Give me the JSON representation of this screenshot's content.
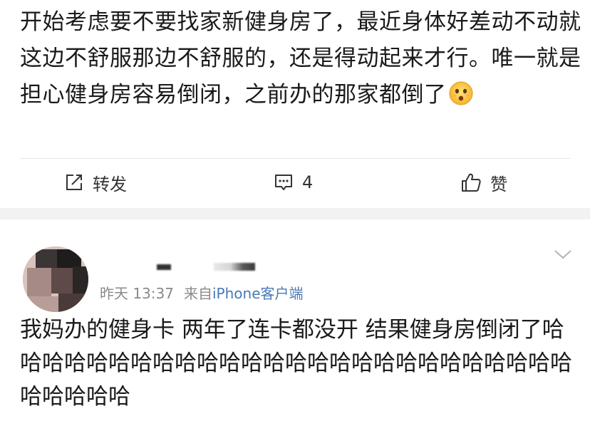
{
  "post": {
    "text": "开始考虑要不要找家新健身房了，最近身体好差动不动就这边不舒服那边不舒服的，还是得动起来才行。唯一就是担心健身房容易倒闭，之前办的那家都倒了",
    "emoji": "hushed-face-emoji",
    "actions": {
      "repost_label": "转发",
      "comment_count": "4",
      "like_label": "赞"
    }
  },
  "comment": {
    "time": "昨天 13:37",
    "source_prefix": "来自",
    "source_client": "iPhone客户端",
    "text": "我妈办的健身卡 两年了连卡都没开 结果健身房倒闭了哈哈哈哈哈哈哈哈哈哈哈哈哈哈哈哈哈哈哈哈哈哈哈哈哈哈哈哈哈哈哈"
  },
  "colors": {
    "text": "#1a1a1a",
    "meta_gray": "#8a8a8a",
    "link_blue": "#4a79b5",
    "section_gap": "#f2f2f2"
  }
}
